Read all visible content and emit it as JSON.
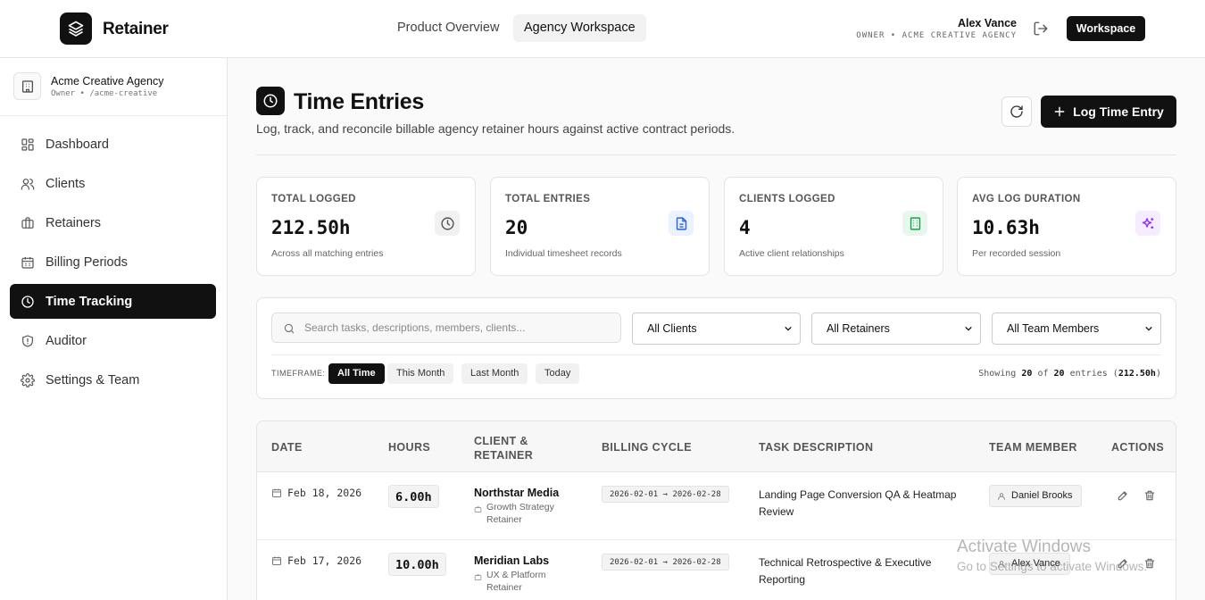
{
  "app": {
    "brand": "Retainer"
  },
  "topnav": {
    "tabs": [
      {
        "label": "Product Overview",
        "active": false
      },
      {
        "label": "Agency Workspace",
        "active": true
      }
    ]
  },
  "user": {
    "name": "Alex Vance",
    "role": "OWNER • ACME CREATIVE AGENCY",
    "workspace_button": "Workspace"
  },
  "sidebar": {
    "org": {
      "name": "Acme Creative Agency",
      "sub": "Owner • /acme-creative"
    },
    "items": [
      {
        "label": "Dashboard",
        "icon": "dashboard-icon",
        "active": false
      },
      {
        "label": "Clients",
        "icon": "users-icon",
        "active": false
      },
      {
        "label": "Retainers",
        "icon": "briefcase-icon",
        "active": false
      },
      {
        "label": "Billing Periods",
        "icon": "calendar-icon",
        "active": false
      },
      {
        "label": "Time Tracking",
        "icon": "clock-icon",
        "active": true
      },
      {
        "label": "Auditor",
        "icon": "shield-icon",
        "active": false
      },
      {
        "label": "Settings & Team",
        "icon": "gear-icon",
        "active": false
      }
    ]
  },
  "page": {
    "title": "Time Entries",
    "subtitle": "Log, track, and reconcile billable agency retainer hours against active contract periods.",
    "log_button": "Log Time Entry"
  },
  "stats": [
    {
      "label": "TOTAL LOGGED",
      "value": "212.50h",
      "note": "Across all matching entries",
      "icon": "clock-icon",
      "icon_color": "#555555",
      "icon_bg": "#f1f1f1"
    },
    {
      "label": "TOTAL ENTRIES",
      "value": "20",
      "note": "Individual timesheet records",
      "icon": "document-icon",
      "icon_color": "#2563eb",
      "icon_bg": "#eaf1ff"
    },
    {
      "label": "CLIENTS LOGGED",
      "value": "4",
      "note": "Active client relationships",
      "icon": "building-icon",
      "icon_color": "#16a34a",
      "icon_bg": "#e8f7ee"
    },
    {
      "label": "AVG LOG DURATION",
      "value": "10.63h",
      "note": "Per recorded session",
      "icon": "sparkles-icon",
      "icon_color": "#9333ea",
      "icon_bg": "#f5ecff"
    }
  ],
  "filters": {
    "search_placeholder": "Search tasks, descriptions, members, clients...",
    "client_select": "All Clients",
    "retainer_select": "All Retainers",
    "member_select": "All Team Members",
    "timeframe_label": "TIMEFRAME:",
    "timeframes": [
      {
        "label": "All Time",
        "active": true
      },
      {
        "label": "This Month",
        "active": false
      },
      {
        "label": "Last Month",
        "active": false
      },
      {
        "label": "Today",
        "active": false
      }
    ],
    "showing": {
      "prefix": "Showing",
      "shown": "20",
      "of": "of",
      "total": "20",
      "suffix": "entries",
      "hours": "212.50h"
    }
  },
  "table": {
    "headers": [
      "DATE",
      "HOURS",
      "CLIENT &\nRETAINER",
      "BILLING CYCLE",
      "TASK DESCRIPTION",
      "TEAM MEMBER",
      "ACTIONS"
    ],
    "rows": [
      {
        "date": "Feb 18, 2026",
        "hours": "6.00h",
        "client": "Northstar Media",
        "retainer": "Growth Strategy Retainer",
        "cycle": "2026-02-01 → 2026-02-28",
        "task": "Landing Page Conversion QA & Heatmap Review",
        "member": "Daniel Brooks"
      },
      {
        "date": "Feb 17, 2026",
        "hours": "10.00h",
        "client": "Meridian Labs",
        "retainer": "UX & Platform Retainer",
        "cycle": "2026-02-01 → 2026-02-28",
        "task": "Technical Retrospective & Executive Reporting",
        "member": "Alex Vance"
      }
    ]
  },
  "overlay": {
    "line1": "Activate Windows",
    "line2": "Go to Settings to activate Windows."
  }
}
